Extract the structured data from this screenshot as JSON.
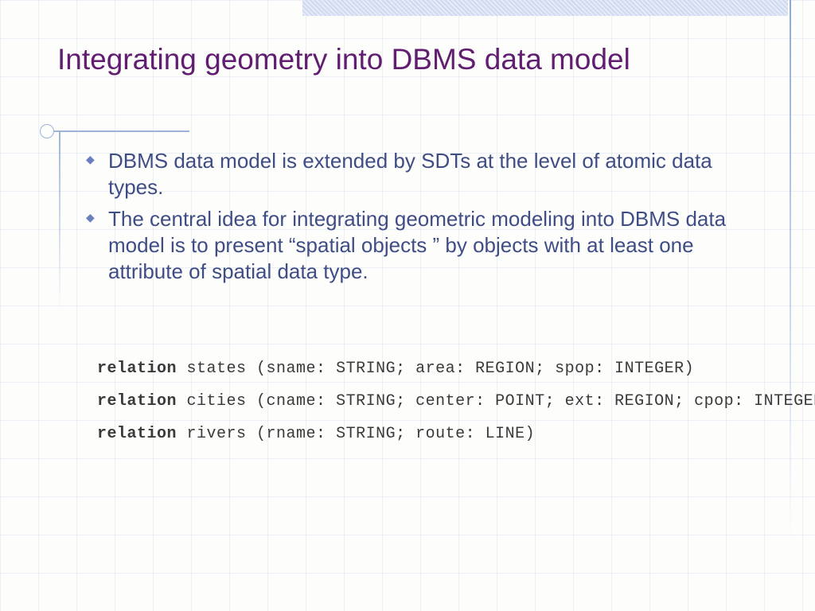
{
  "title": "Integrating geometry into DBMS data model",
  "bullets": [
    "DBMS data model is extended by SDTs at the level of atomic data types.",
    "The central idea for integrating geometric modeling into DBMS data model is to present “spatial objects ” by objects with at least one attribute of spatial data type."
  ],
  "relations": [
    {
      "keyword": "relation",
      "name": "states",
      "sig": "(sname: STRING; area: REGION; spop: INTEGER)"
    },
    {
      "keyword": "relation",
      "name": "cities",
      "sig": "(cname: STRING; center: POINT; ext: REGION; cpop: INTEGER)"
    },
    {
      "keyword": "relation",
      "name": "rivers",
      "sig": "(rname: STRING; route: LINE)"
    }
  ]
}
